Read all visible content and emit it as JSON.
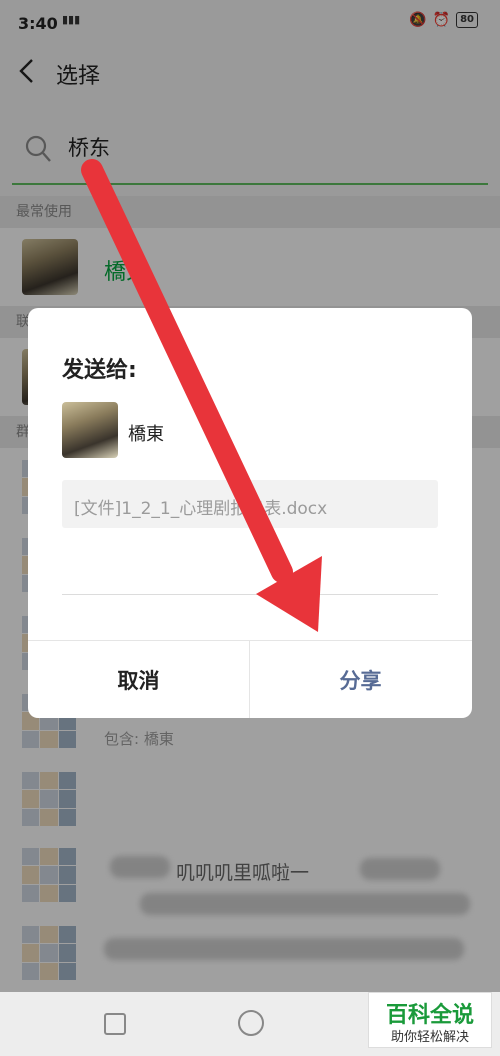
{
  "status_bar": {
    "time": "3:40",
    "signal": "ᴴᴰ",
    "battery": "80"
  },
  "nav": {
    "title": "选择"
  },
  "search": {
    "value": "桥东"
  },
  "sections": {
    "recent": "最常使用",
    "contacts": "联",
    "groups": "群"
  },
  "recent_contact": {
    "name": "橋東"
  },
  "groups_list": {
    "member_line": "包含: 橋東",
    "blurred_title": "叽叽叽里呱啦一"
  },
  "dialog": {
    "title": "发送给:",
    "contact_name": "橋東",
    "file_label": "[文件]1_2_1_心理剧报名表.docx",
    "cancel_label": "取消",
    "share_label": "分享"
  },
  "watermark": {
    "title": "百科全说",
    "subtitle": "助你轻松解决"
  },
  "colors": {
    "accent_green": "#07a340",
    "share_blue": "#576b95",
    "arrow_red": "#e8343a"
  }
}
